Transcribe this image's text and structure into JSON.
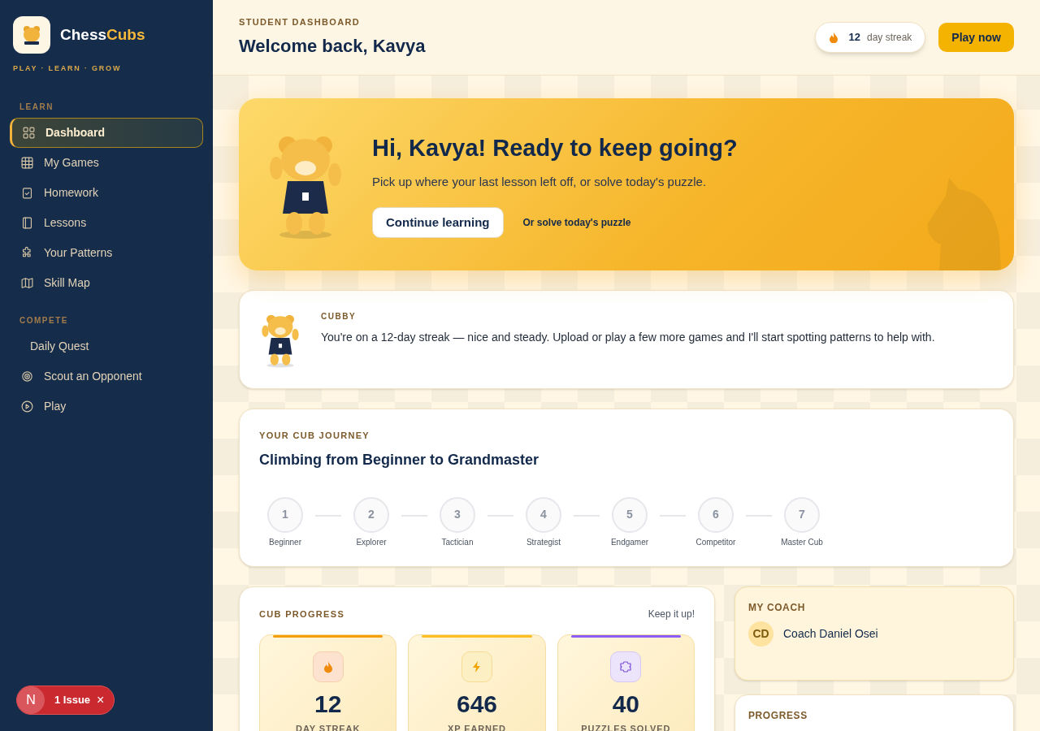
{
  "brand": {
    "name_part_1": "Chess",
    "name_part_2": "Cubs",
    "tagline": "PLAY · LEARN · GROW"
  },
  "sidebar": {
    "sections": [
      {
        "heading": "LEARN",
        "items": [
          {
            "label": "Dashboard",
            "selected": true
          },
          {
            "label": "My Games",
            "selected": false
          },
          {
            "label": "Homework",
            "selected": false
          },
          {
            "label": "Lessons",
            "selected": false
          },
          {
            "label": "Your Patterns",
            "selected": false
          },
          {
            "label": "Skill Map",
            "selected": false
          }
        ]
      },
      {
        "heading": "COMPETE",
        "items": [
          {
            "label": "Daily Quest",
            "selected": false
          },
          {
            "label": "Scout an Opponent",
            "selected": false
          },
          {
            "label": "Play",
            "selected": false
          }
        ]
      }
    ]
  },
  "issue_badge": {
    "letter": "N",
    "label": "1 Issue",
    "close": "×"
  },
  "header": {
    "eyebrow": "STUDENT DASHBOARD",
    "title": "Welcome back, Kavya",
    "streak": {
      "count": "12",
      "label": "day streak"
    },
    "button": "Play now"
  },
  "hero": {
    "title": "Hi, Kavya! Ready to keep going?",
    "subtitle": "Pick up where your last lesson left off, or solve today's puzzle.",
    "primary_button": "Continue learning",
    "link": "Or solve today's puzzle"
  },
  "cubby": {
    "label": "CUBBY",
    "message": "You're on a 12-day streak — nice and steady. Upload or play a few more games and I'll start spotting patterns to help with."
  },
  "journey": {
    "eyebrow": "YOUR CUB JOURNEY",
    "title": "Climbing from Beginner to Grandmaster",
    "steps": [
      {
        "number": "1",
        "label": "Beginner"
      },
      {
        "number": "2",
        "label": "Explorer"
      },
      {
        "number": "3",
        "label": "Tactician"
      },
      {
        "number": "4",
        "label": "Strategist"
      },
      {
        "number": "5",
        "label": "Endgamer"
      },
      {
        "number": "6",
        "label": "Competitor"
      },
      {
        "number": "7",
        "label": "Master Cub"
      }
    ]
  },
  "progress": {
    "eyebrow": "CUB PROGRESS",
    "note": "Keep it up!",
    "stats": [
      {
        "kind": "streak",
        "value": "12",
        "label": "DAY STREAK",
        "color": "#f59e0b"
      },
      {
        "kind": "xp",
        "value": "646",
        "label": "XP EARNED",
        "color": "#fbbf24"
      },
      {
        "kind": "puzzles",
        "value": "40",
        "label": "PUZZLES SOLVED",
        "color": "#8b5cf6"
      }
    ]
  },
  "coach": {
    "eyebrow": "MY COACH",
    "initials": "CD",
    "name": "Coach Daniel Osei"
  },
  "progress_card": {
    "eyebrow": "PROGRESS"
  }
}
